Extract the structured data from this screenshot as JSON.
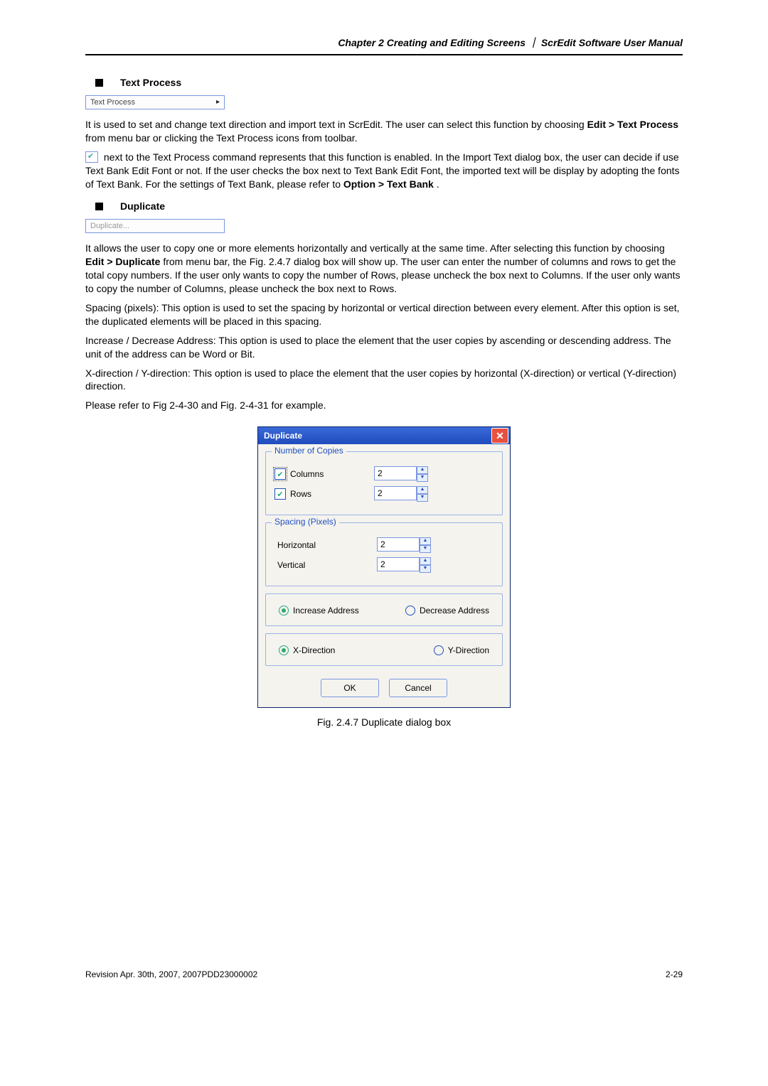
{
  "header": {
    "chapter": "Chapter 2  Creating and Editing Screens",
    "sep": "｜",
    "manual": "ScrEdit Software User Manual"
  },
  "section1": {
    "title": "Text Process",
    "menu_label": "Text Process",
    "p1a": "It is used to set and change text direction and import text in ScrEdit. The user can select this function by choosing ",
    "p1b_bold": "Edit > Text Process",
    "p1c": " from menu bar or clicking the Text Process icons from toolbar.",
    "p2a": " next to the Text Process command represents that this function is enabled. In the Import Text dialog box, the user can decide if use Text Bank Edit Font or not. If the user checks the box next to Text Bank Edit Font, the imported text will be display by adopting the fonts of Text Bank. For the settings of Text Bank, please refer to ",
    "p2b_bold": "Option > Text Bank",
    "p2c": "."
  },
  "section2": {
    "title": "Duplicate",
    "menu_label": "Duplicate...",
    "p1a": "It allows the user to copy one or more elements horizontally and vertically at the same time. After selecting this function by choosing ",
    "p1b_bold": "Edit > Duplicate",
    "p1c": " from menu bar, the Fig. 2.4.7 dialog box will show up. The user can enter the number of columns and rows to get the total copy numbers. If the user only wants to copy the number of Rows, please uncheck the box next to Columns. If the user only wants to copy the number of Columns, please uncheck the box next to Rows.",
    "p2": "Spacing (pixels): This option is used to set the spacing by horizontal or vertical direction between every element. After this option is set, the duplicated elements will be placed in this spacing.",
    "p3": "Increase / Decrease Address: This option is used to place the element that the user copies by ascending or descending address. The unit of the address can be Word or Bit.",
    "p4": "X-direction / Y-direction: This option is used to place the element that the user copies by horizontal (X-direction) or vertical (Y-direction) direction.",
    "p5": "Please refer to Fig 2-4-30 and Fig. 2-4-31 for example."
  },
  "dialog": {
    "title": "Duplicate",
    "group1_title": "Number of Copies",
    "columns_label": "Columns",
    "columns_value": "2",
    "rows_label": "Rows",
    "rows_value": "2",
    "group2_title": "Spacing (Pixels)",
    "horiz_label": "Horizontal",
    "horiz_value": "2",
    "vert_label": "Vertical",
    "vert_value": "2",
    "inc_addr": "Increase Address",
    "dec_addr": "Decrease Address",
    "xdir": "X-Direction",
    "ydir": "Y-Direction",
    "ok": "OK",
    "cancel": "Cancel"
  },
  "caption": "Fig. 2.4.7 Duplicate dialog box",
  "footer": {
    "left": "Revision Apr. 30th, 2007, 2007PDD23000002",
    "right": "2-29"
  }
}
